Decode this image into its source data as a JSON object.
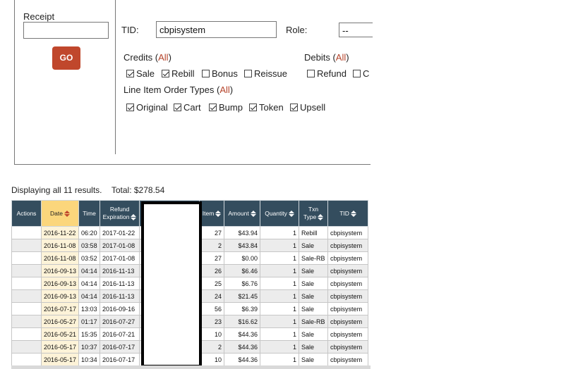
{
  "filters": {
    "receipt_label": "Receipt",
    "receipt_value": "",
    "go_label": "GO",
    "tid_label": "TID:",
    "tid_value": "cbpisystem",
    "role_label": "Role:",
    "role_value": "--",
    "credits": {
      "label": "Credits (",
      "all_label": "All",
      "close": ")",
      "options": [
        {
          "label": "Sale",
          "checked": true
        },
        {
          "label": "Rebill",
          "checked": true
        },
        {
          "label": "Bonus",
          "checked": false
        },
        {
          "label": "Reissue",
          "checked": false
        }
      ]
    },
    "debits": {
      "label": "Debits (",
      "all_label": "All",
      "close": ")",
      "options": [
        {
          "label": "Refund",
          "checked": false
        },
        {
          "label": "C",
          "checked": false
        }
      ]
    },
    "line_item_types": {
      "label": "Line Item Order Types (",
      "all_label": "All",
      "close": ")",
      "options": [
        {
          "label": "Original",
          "checked": true
        },
        {
          "label": "Cart",
          "checked": true
        },
        {
          "label": "Bump",
          "checked": true
        },
        {
          "label": "Token",
          "checked": true
        },
        {
          "label": "Upsell",
          "checked": true
        }
      ]
    }
  },
  "results": {
    "summary": "Displaying all 11 results.",
    "total_label": "Total: $278.54",
    "columns": {
      "actions": "Actions",
      "date": "Date",
      "time": "Time",
      "refund_expiration_1": "Refund",
      "refund_expiration_2": "Expiration",
      "item": "Item",
      "amount": "Amount",
      "quantity": "Quantity",
      "txn_type_1": "Txn",
      "txn_type_2": "Type",
      "tid": "TID"
    },
    "rows": [
      {
        "actions": "",
        "date": "2016-11-22",
        "time": "06:20",
        "expiration": "2017-01-22",
        "item": "27",
        "amount": "$43.94",
        "quantity": "1",
        "type": "Rebill",
        "tid": "cbpisystem"
      },
      {
        "actions": "",
        "date": "2016-11-08",
        "time": "03:58",
        "expiration": "2017-01-08",
        "item": "2",
        "amount": "$43.84",
        "quantity": "1",
        "type": "Sale",
        "tid": "cbpisystem"
      },
      {
        "actions": "",
        "date": "2016-11-08",
        "time": "03:52",
        "expiration": "2017-01-08",
        "item": "27",
        "amount": "$0.00",
        "quantity": "1",
        "type": "Sale-RB",
        "tid": "cbpisystem"
      },
      {
        "actions": "",
        "date": "2016-09-13",
        "time": "04:14",
        "expiration": "2016-11-13",
        "item": "26",
        "amount": "$6.46",
        "quantity": "1",
        "type": "Sale",
        "tid": "cbpisystem"
      },
      {
        "actions": "",
        "date": "2016-09-13",
        "time": "04:14",
        "expiration": "2016-11-13",
        "item": "25",
        "amount": "$6.76",
        "quantity": "1",
        "type": "Sale",
        "tid": "cbpisystem"
      },
      {
        "actions": "",
        "date": "2016-09-13",
        "time": "04:14",
        "expiration": "2016-11-13",
        "item": "24",
        "amount": "$21.45",
        "quantity": "1",
        "type": "Sale",
        "tid": "cbpisystem"
      },
      {
        "actions": "",
        "date": "2016-07-17",
        "time": "13:03",
        "expiration": "2016-09-16",
        "item": "56",
        "amount": "$6.39",
        "quantity": "1",
        "type": "Sale",
        "tid": "cbpisystem"
      },
      {
        "actions": "",
        "date": "2016-05-27",
        "time": "01:17",
        "expiration": "2016-07-27",
        "item": "23",
        "amount": "$16.62",
        "quantity": "1",
        "type": "Sale-RB",
        "tid": "cbpisystem"
      },
      {
        "actions": "",
        "date": "2016-05-21",
        "time": "15:35",
        "expiration": "2016-07-21",
        "item": "10",
        "amount": "$44.36",
        "quantity": "1",
        "type": "Sale",
        "tid": "cbpisystem"
      },
      {
        "actions": "",
        "date": "2016-05-17",
        "time": "10:37",
        "expiration": "2016-07-17",
        "item": "2",
        "amount": "$44.36",
        "quantity": "1",
        "type": "Sale",
        "tid": "cbpisystem"
      },
      {
        "actions": "",
        "date": "2016-05-17",
        "time": "10:34",
        "expiration": "2016-07-17",
        "item": "10",
        "amount": "$44.36",
        "quantity": "1",
        "type": "Sale",
        "tid": "cbpisystem"
      }
    ]
  },
  "colors": {
    "header_bg": "#344d5e",
    "sorted_header_bg": "#fbd67c",
    "go_button": "#c0472c",
    "link": "#b5432a"
  }
}
